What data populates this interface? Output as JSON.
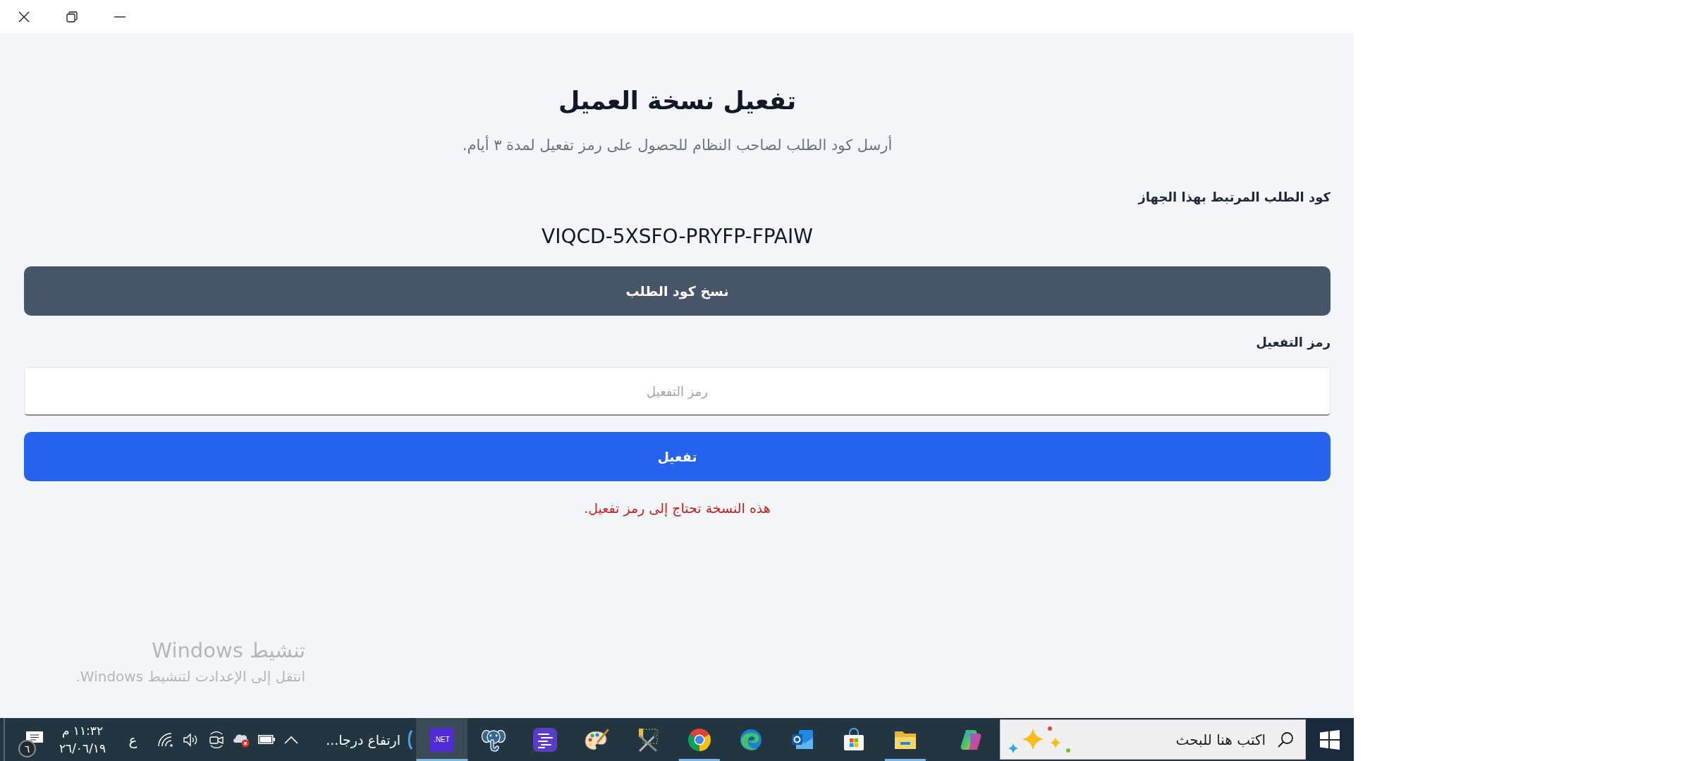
{
  "window": {
    "controls": [
      {
        "kind": "close"
      },
      {
        "kind": "restore"
      },
      {
        "kind": "minimize"
      }
    ]
  },
  "page": {
    "title": "تفعيل نسخة العميل",
    "subtitle": "أرسل كود الطلب لصاحب النظام للحصول على رمز تفعيل لمدة ٣ أيام."
  },
  "request_code": {
    "label": "كود الطلب المرتبط بهذا الجهاز",
    "value": "VIQCD-5XSFO-PRYFP-FPAIW",
    "copy_button": "نسخ كود الطلب"
  },
  "activation": {
    "label": "رمز التفعيل",
    "placeholder": "رمز التفعيل",
    "button": "تفعيل",
    "message": "هذه النسخة تحتاج إلى رمز تفعيل."
  },
  "activation_notice": {
    "title": "تنشيط Windows",
    "text": "انتقل إلى الإعدادت لتنشيط Windows."
  },
  "taskbar": {
    "search": {
      "placeholder": "اكتب هنا للبحث"
    },
    "apps": [
      {
        "kind": "copilot",
        "selected": false,
        "running": false
      },
      {
        "kind": "explorer",
        "selected": false,
        "running": true
      },
      {
        "kind": "store",
        "selected": false,
        "running": false
      },
      {
        "kind": "outlook",
        "selected": false,
        "running": false
      },
      {
        "kind": "edge",
        "selected": false,
        "running": false
      },
      {
        "kind": "chrome",
        "selected": false,
        "running": true
      },
      {
        "kind": "tools",
        "selected": false,
        "running": false
      },
      {
        "kind": "paint",
        "selected": false,
        "running": false
      },
      {
        "kind": "editor",
        "selected": false,
        "running": false
      },
      {
        "kind": "database",
        "selected": false,
        "running": false
      },
      {
        "kind": "dotnet",
        "label": ".NET",
        "selected": true,
        "running": true
      }
    ],
    "weather": {
      "text": "ارتفاع درجا..."
    },
    "tray": {
      "icons": [
        {
          "kind": "chevron"
        },
        {
          "kind": "battery"
        },
        {
          "kind": "cloud_error"
        },
        {
          "kind": "camera"
        },
        {
          "kind": "volume"
        },
        {
          "kind": "wifi"
        }
      ],
      "language": "ع",
      "time": "١١:٣٢ م",
      "date": "٢٦/٠٦/١٩",
      "notifications": "٦"
    }
  }
}
